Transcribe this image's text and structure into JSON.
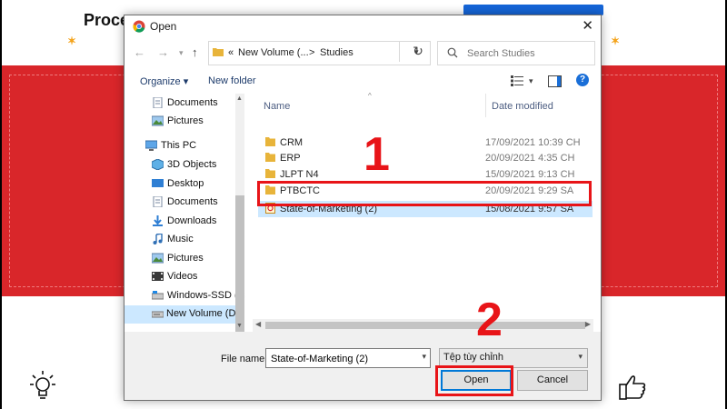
{
  "background": {
    "page_title": "Proce",
    "accent_red": "#d9262a",
    "accent_blue": "#1565d8"
  },
  "dialog": {
    "title": "Open",
    "app_icon": "chrome-icon",
    "address": {
      "overflow": "«",
      "crumb1": "New Volume (...",
      "sep": ">",
      "crumb2": "Studies"
    },
    "search": {
      "placeholder": "Search Studies"
    },
    "toolbar": {
      "organize": "Organize ▾",
      "new_folder": "New folder"
    },
    "nav_items": [
      {
        "label": "Documents",
        "icon": "documents-icon"
      },
      {
        "label": "Pictures",
        "icon": "pictures-icon"
      },
      {
        "label": "This PC",
        "icon": "computer-icon"
      },
      {
        "label": "3D Objects",
        "icon": "3d-objects-icon"
      },
      {
        "label": "Desktop",
        "icon": "desktop-icon"
      },
      {
        "label": "Documents",
        "icon": "documents-icon"
      },
      {
        "label": "Downloads",
        "icon": "downloads-icon"
      },
      {
        "label": "Music",
        "icon": "music-icon"
      },
      {
        "label": "Pictures",
        "icon": "pictures-icon"
      },
      {
        "label": "Videos",
        "icon": "videos-icon"
      },
      {
        "label": "Windows-SSD (C",
        "icon": "drive-icon"
      },
      {
        "label": "New Volume (D:)",
        "icon": "drive-icon"
      }
    ],
    "columns": {
      "name": "Name",
      "date": "Date modified"
    },
    "files": [
      {
        "name": "CRM",
        "date": "17/09/2021 10:39 CH",
        "type": "folder"
      },
      {
        "name": "ERP",
        "date": "20/09/2021 4:35 CH",
        "type": "folder"
      },
      {
        "name": "JLPT N4",
        "date": "15/09/2021 9:13 CH",
        "type": "folder"
      },
      {
        "name": "PTBCTC",
        "date": "20/09/2021 9:29 SA",
        "type": "folder"
      },
      {
        "name": "State-of-Marketing (2)",
        "date": "15/08/2021 9:57 SA",
        "type": "file"
      }
    ],
    "file_name_label": "File name:",
    "file_name_value": "State-of-Marketing (2)",
    "file_type": "Tệp tùy chỉnh",
    "open_label": "Open",
    "cancel_label": "Cancel"
  },
  "annotations": {
    "step1": "1",
    "step2": "2",
    "color": "#e81418"
  }
}
